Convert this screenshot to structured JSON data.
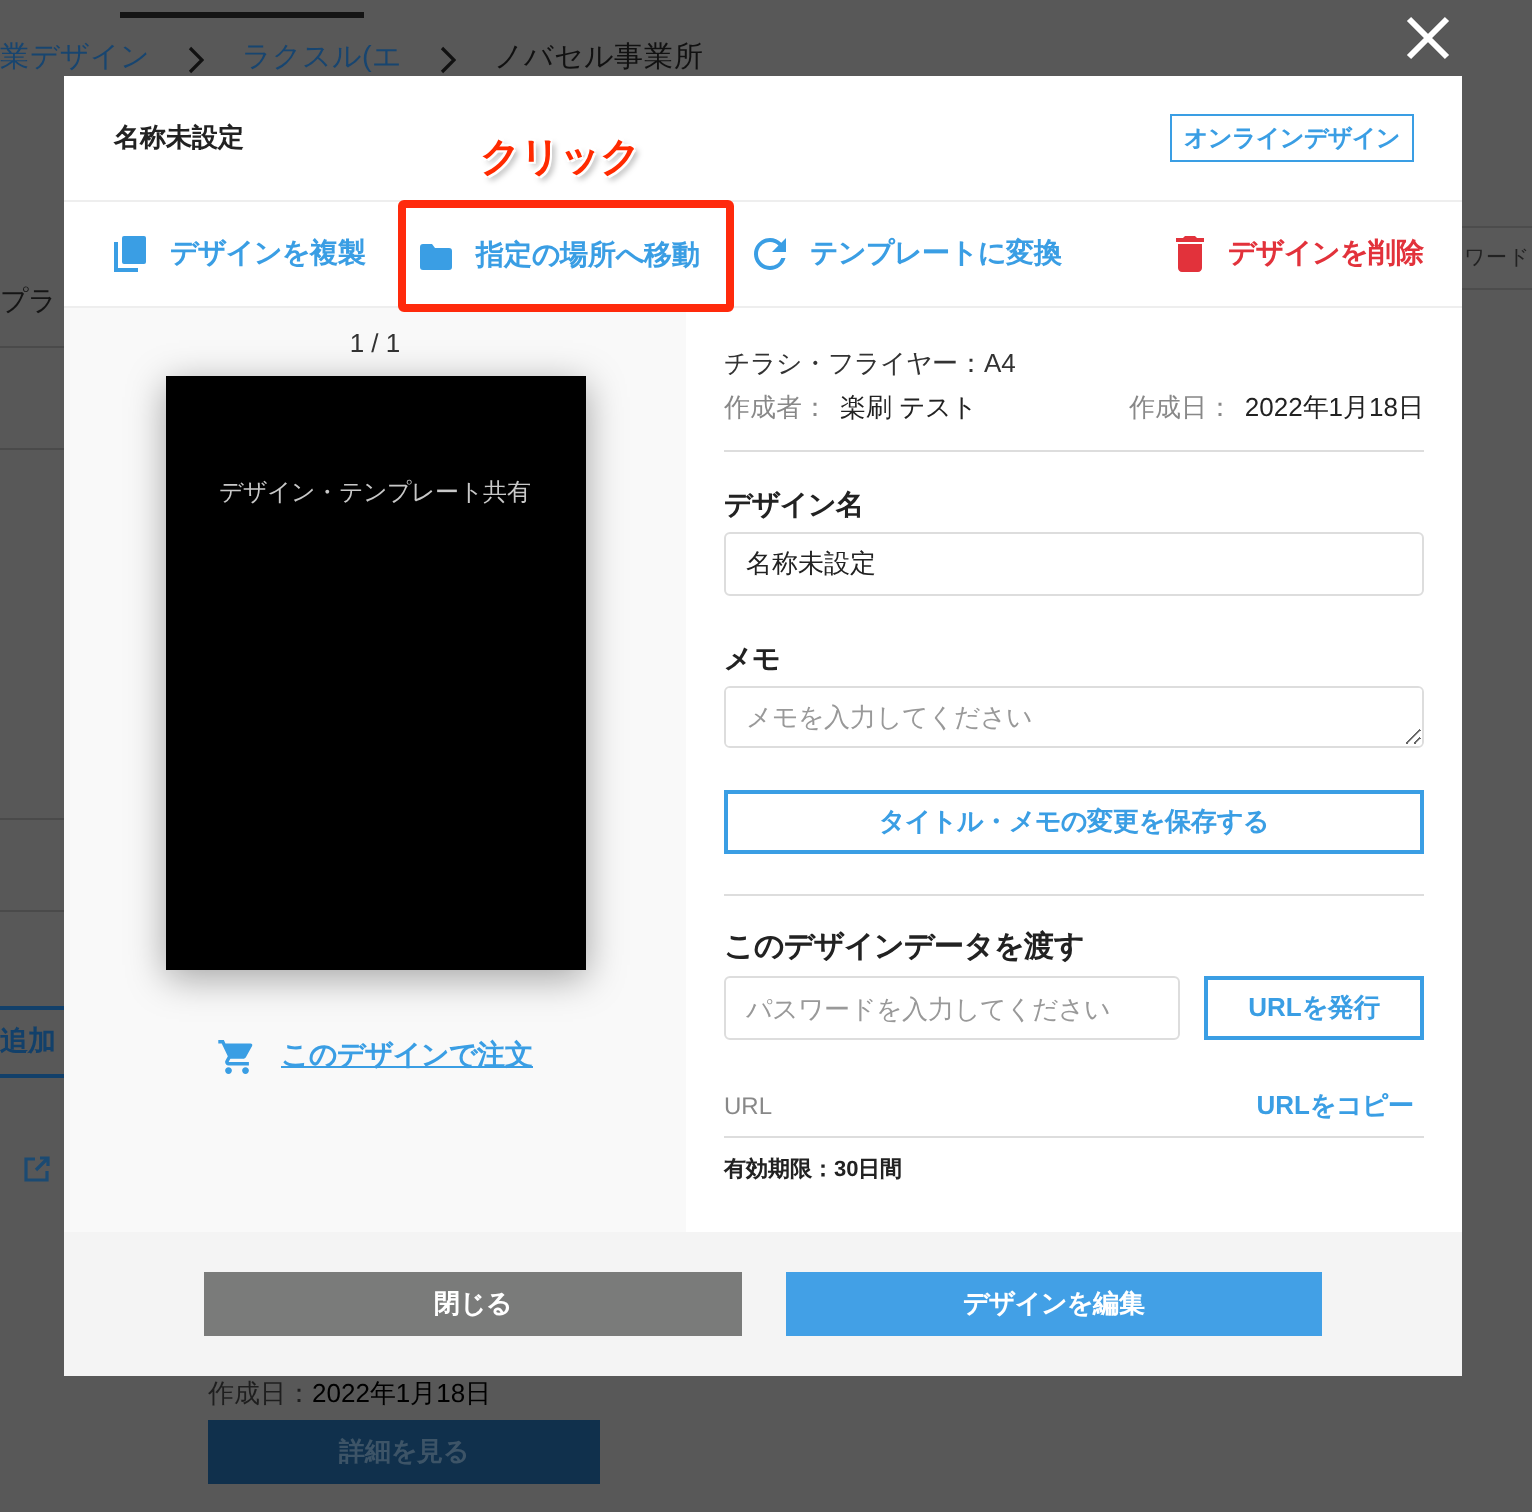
{
  "background_page": {
    "breadcrumb": [
      {
        "label": "業デザイン",
        "kind": "link"
      },
      {
        "label": "ラクスル(エ",
        "kind": "link"
      },
      {
        "label": "ノバセル事業所",
        "kind": "current"
      }
    ],
    "side_label": "プラ",
    "add_button": "追加",
    "right_field": {
      "placeholder": "ワード"
    },
    "card": {
      "date_label": "作成日：",
      "date": "2022年1月18日",
      "details_button": "詳細を見る"
    }
  },
  "modal": {
    "title": "名称未設定",
    "badge": "オンラインデザイン",
    "actions": [
      {
        "label": "デザインを複製",
        "kind": "copy",
        "highlighted": false
      },
      {
        "label": "指定の場所へ移動",
        "kind": "move",
        "highlighted": true
      },
      {
        "label": "テンプレートに変換",
        "kind": "convert",
        "highlighted": false
      },
      {
        "label": "デザインを削除",
        "kind": "delete",
        "highlighted": false
      }
    ],
    "annotation": {
      "label": "クリック"
    },
    "preview": {
      "pager": "1 / 1",
      "design_text": "デザイン・テンプレート共有",
      "order_link": "このデザインで注文"
    },
    "details": {
      "product": "チラシ・フライヤー：A4",
      "author_label": "作成者：",
      "author": "楽刷 テスト",
      "date_label": "作成日：",
      "date": "2022年1月18日"
    },
    "name_field": {
      "label": "デザイン名",
      "value": "名称未設定"
    },
    "memo_field": {
      "label": "メモ",
      "placeholder": "メモを入力してください"
    },
    "save_button": "タイトル・メモの変更を保存する",
    "share": {
      "heading": "このデザインデータを渡す",
      "password_field": {
        "placeholder": "パスワードを入力してください"
      },
      "issue_button": "URLを発行",
      "url_label": "URL",
      "copy_link": "URLをコピー",
      "expiry": "有効期限：30日間"
    },
    "footer_buttons": [
      {
        "label": "閉じる",
        "kind": "secondary"
      },
      {
        "label": "デザインを編集",
        "kind": "primary"
      }
    ]
  }
}
